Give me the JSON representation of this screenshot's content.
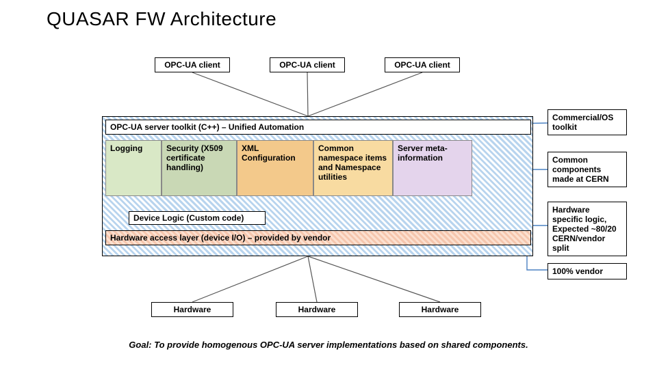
{
  "title": "QUASAR FW Architecture",
  "clients": [
    "OPC-UA client",
    "OPC-UA client",
    "OPC-UA client"
  ],
  "server_toolkit": "OPC-UA server toolkit (C++) – Unified Automation",
  "components": {
    "logging": "Logging",
    "security": "Security (X509 certificate handling)",
    "xml": "XML Configuration",
    "namespace": "Common namespace items and Namespace utilities",
    "meta": "Server meta-information"
  },
  "device_logic": "Device Logic (Custom code)",
  "hw_access": "Hardware access layer (device I/O) – provided by vendor",
  "hardware": [
    "Hardware",
    "Hardware",
    "Hardware"
  ],
  "labels": {
    "commercial": "Commercial/OS toolkit",
    "cern": "Common components made at CERN",
    "hw_logic": "Hardware specific logic, Expected ~80/20 CERN/vendor split",
    "vendor": "100% vendor"
  },
  "goal": "Goal: To provide homogenous OPC-UA server implementations based on shared components."
}
